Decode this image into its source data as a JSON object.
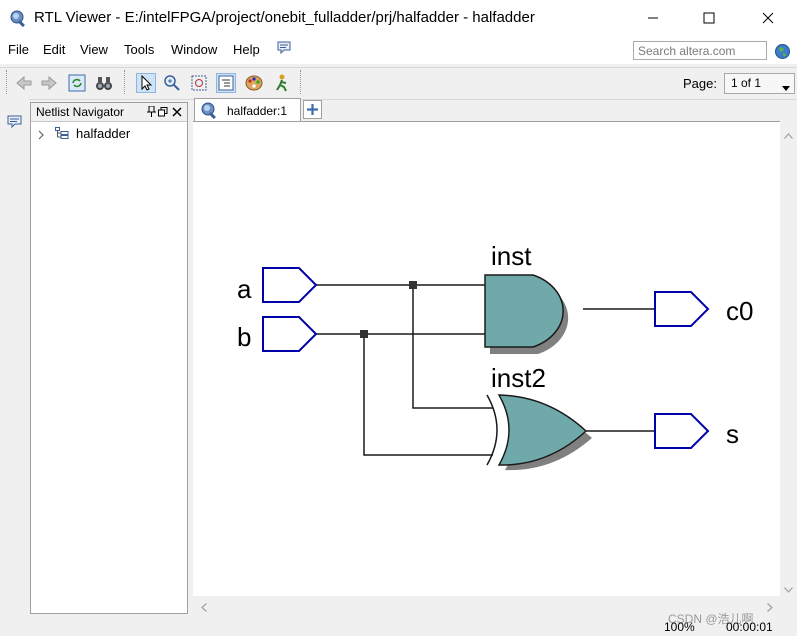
{
  "window": {
    "title": "RTL Viewer - E:/intelFPGA/project/onebit_fulladder/prj/halfadder - halfadder"
  },
  "menu": {
    "items": [
      "File",
      "Edit",
      "View",
      "Tools",
      "Window",
      "Help"
    ]
  },
  "search": {
    "placeholder": "Search altera.com"
  },
  "toolbar": {
    "page_label": "Page:",
    "page_value": "1 of 1"
  },
  "navigator": {
    "title": "Netlist Navigator",
    "tree": [
      {
        "label": "halfadder"
      }
    ]
  },
  "tabs": [
    {
      "label": "halfadder:1"
    }
  ],
  "schematic": {
    "inputs": [
      "a",
      "b"
    ],
    "outputs": [
      "c0",
      "s"
    ],
    "gates": [
      {
        "name": "inst",
        "type": "AND"
      },
      {
        "name": "inst2",
        "type": "XOR"
      }
    ],
    "gate_color": "#6fa9a9",
    "port_color": "#0000a8"
  },
  "status": {
    "zoom": "100%",
    "time": "00:00:01",
    "watermark": "CSDN @浩儿啊"
  }
}
